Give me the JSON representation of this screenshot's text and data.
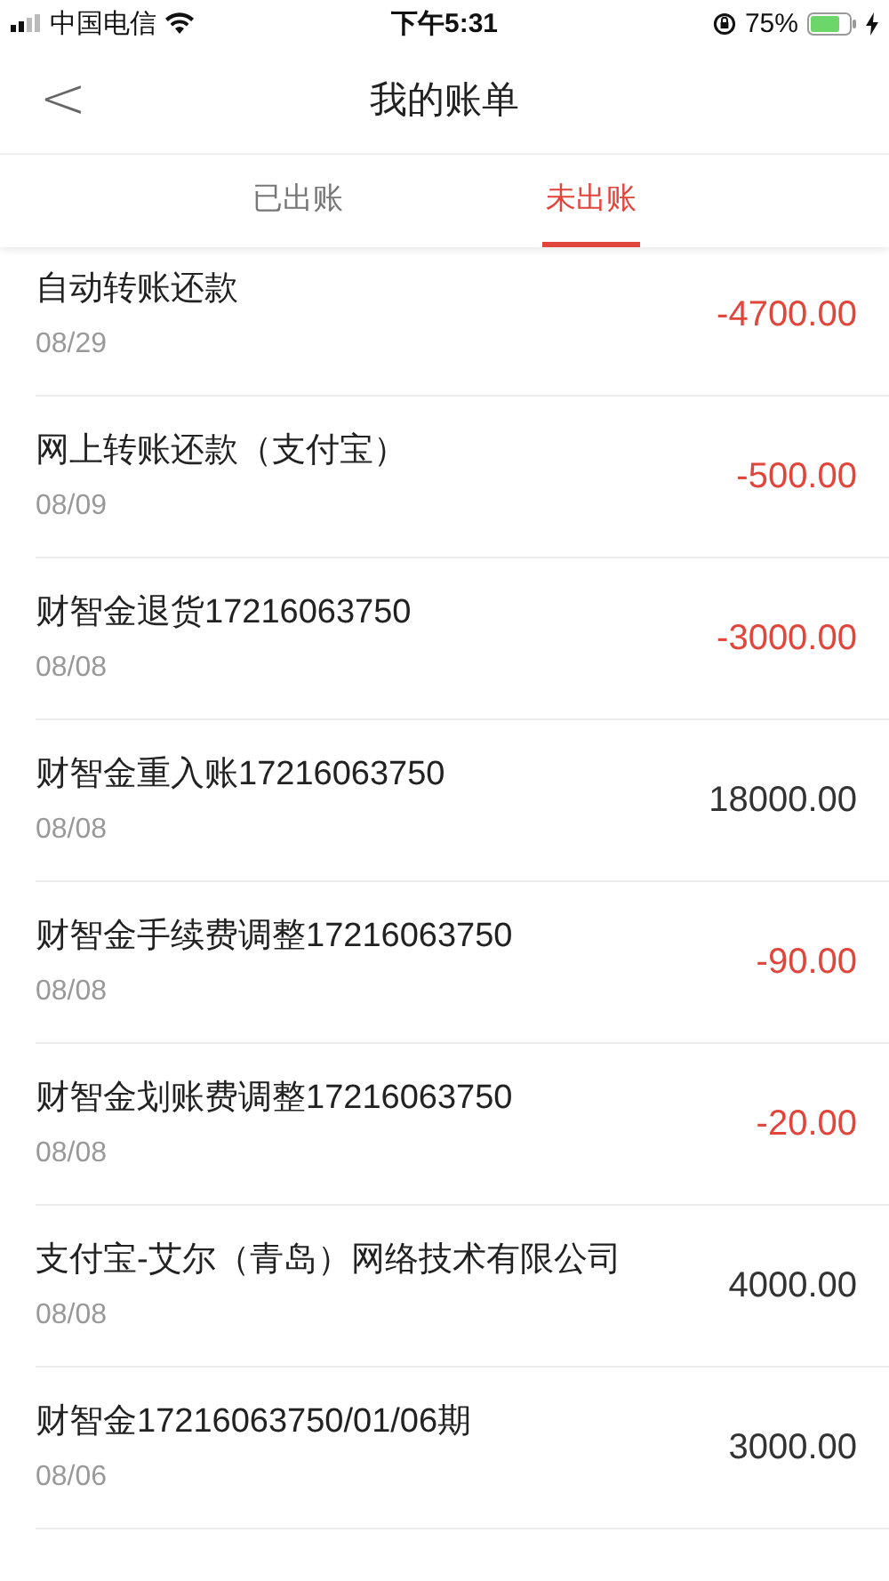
{
  "status_bar": {
    "carrier": "中国电信",
    "time": "下午5:31",
    "battery": "75%"
  },
  "nav": {
    "back": "<",
    "title": "我的账单"
  },
  "tabs": [
    {
      "label": "已出账",
      "selected": false
    },
    {
      "label": "未出账",
      "selected": true
    }
  ],
  "bills": [
    {
      "title": "自动转账还款",
      "date": "08/29",
      "amount": "-4700.00",
      "color": "#e0463b"
    },
    {
      "title": "网上转账还款（支付宝）",
      "date": "08/09",
      "amount": "-500.00",
      "color": "#e0463b"
    },
    {
      "title": "财智金退货17216063750",
      "date": "08/08",
      "amount": "-3000.00",
      "color": "#e0463b"
    },
    {
      "title": "财智金重入账17216063750",
      "date": "08/08",
      "amount": "18000.00",
      "color": "#333333"
    },
    {
      "title": "财智金手续费调整17216063750",
      "date": "08/08",
      "amount": "-90.00",
      "color": "#e0463b"
    },
    {
      "title": "财智金划账费调整17216063750",
      "date": "08/08",
      "amount": "-20.00",
      "color": "#e0463b"
    },
    {
      "title": "支付宝-艾尔（青岛）网络技术有限公司",
      "date": "08/08",
      "amount": "4000.00",
      "color": "#333333"
    },
    {
      "title": "财智金17216063750/01/06期",
      "date": "08/06",
      "amount": "3000.00",
      "color": "#333333"
    }
  ]
}
